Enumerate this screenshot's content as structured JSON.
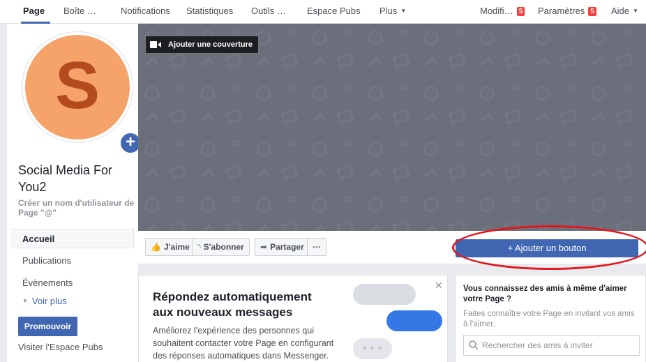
{
  "nav": {
    "tabs": [
      {
        "label": "Page"
      },
      {
        "label": "Boîte …"
      },
      {
        "label": "Notifications"
      },
      {
        "label": "Statistiques"
      },
      {
        "label": "Outils …"
      },
      {
        "label": "Espace Pubs"
      },
      {
        "label": "Plus"
      },
      {
        "label": "Modifi…",
        "badge": "5"
      },
      {
        "label": "Paramètres",
        "badge": "5"
      },
      {
        "label": "Aide"
      }
    ]
  },
  "profile": {
    "avatar_letter": "S",
    "avatar_bg": "#f6a36a",
    "avatar_letter_color": "#b34b1f",
    "page_name": "Social Media For You2",
    "username_prompt": "Créer un nom d'utilisateur de Page \"@\""
  },
  "sidebar": {
    "items": [
      {
        "label": "Accueil",
        "active": true
      },
      {
        "label": "Publications"
      },
      {
        "label": "Évènements"
      },
      {
        "label": "Voir plus"
      }
    ],
    "promote_label": "Promouvoir",
    "visit_ads_label": "Visiter l'Espace Pubs"
  },
  "cover": {
    "add_cover_label": "Ajouter une couverture",
    "background": "#6b6f7b"
  },
  "actions": {
    "like_label": "J'aime",
    "follow_label": "S'abonner",
    "share_label": "Partager",
    "more_label": "···",
    "add_button_label": "+ Ajouter un bouton"
  },
  "messaging_card": {
    "title": "Répondez automatiquement aux nouveaux messages",
    "body": "Améliorez l'expérience des personnes qui souhaitent contacter votre Page en configurant des réponses automatiques dans Messenger.",
    "typing_dots": "● ● ●"
  },
  "invite_card": {
    "title": "Vous connaissez des amis à même d'aimer votre Page ?",
    "description": "Faites connaître votre Page en invitant vos amis à l'aimer.",
    "search_placeholder": "Rechercher des amis à inviter"
  },
  "colors": {
    "brand": "#4267b2",
    "badge": "#fa3e3e",
    "highlight_ellipse": "#e2181e"
  }
}
